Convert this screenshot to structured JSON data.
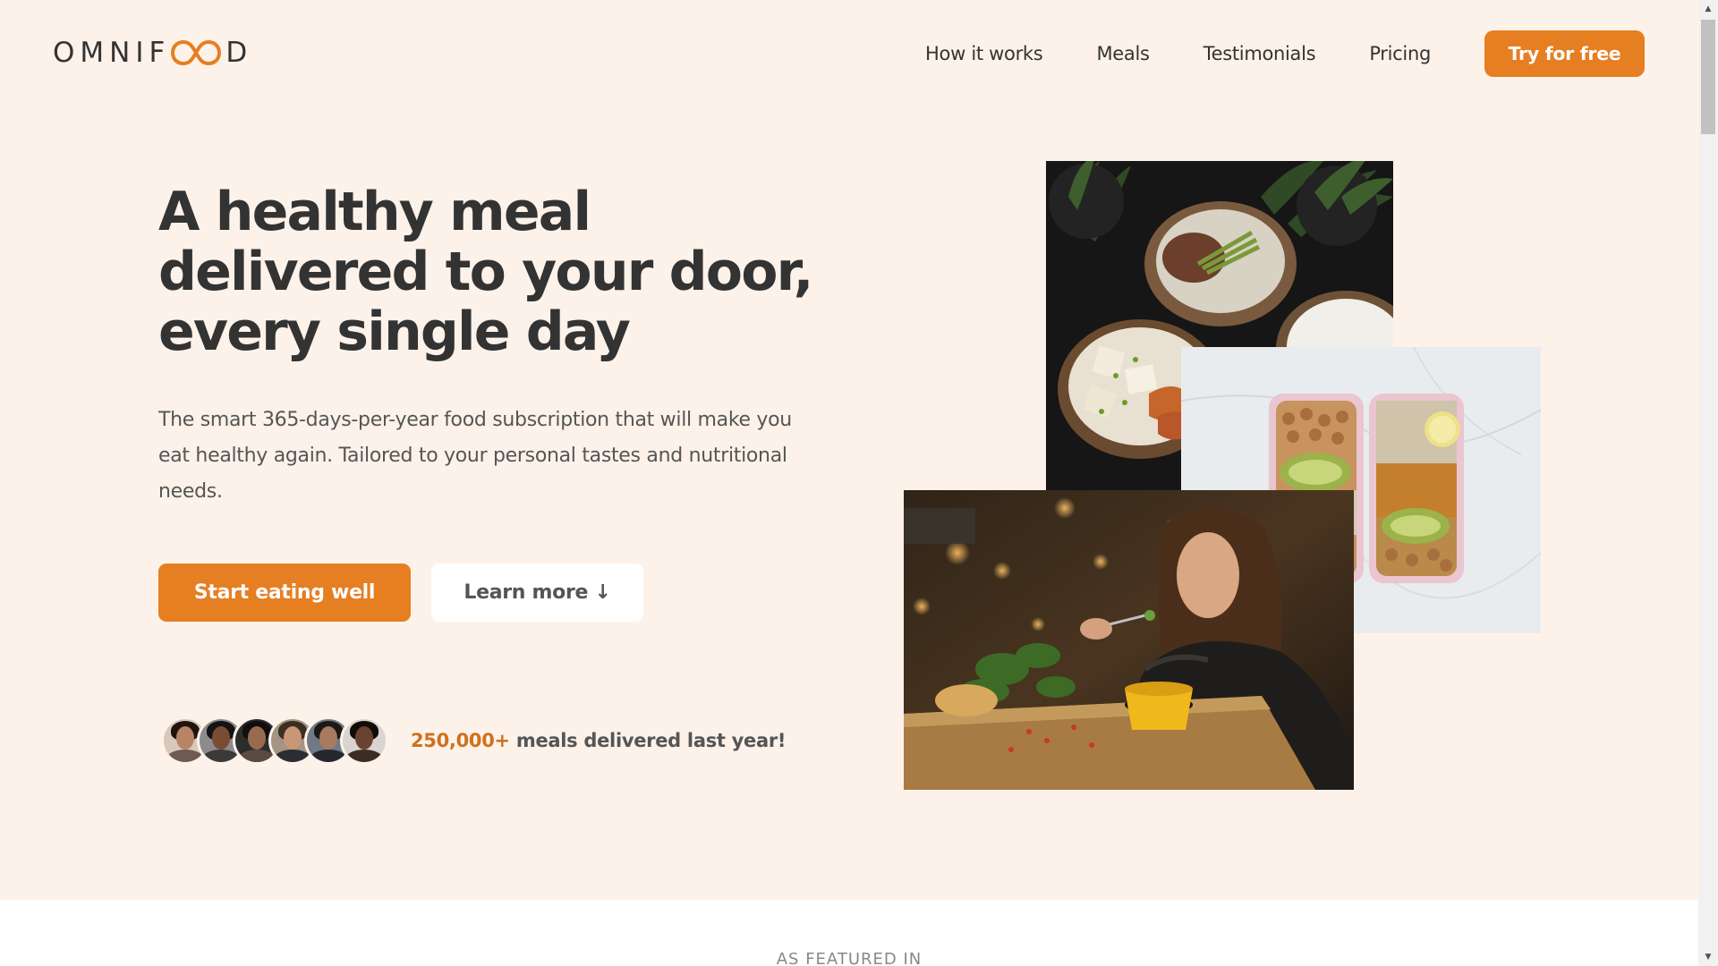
{
  "header": {
    "logo_text_left": "OMNIF",
    "logo_text_right": "D",
    "nav": [
      {
        "label": "How it works"
      },
      {
        "label": "Meals"
      },
      {
        "label": "Testimonials"
      },
      {
        "label": "Pricing"
      }
    ],
    "cta_label": "Try for free"
  },
  "hero": {
    "title": "A healthy meal delivered to your door, every single day",
    "description": "The smart 365-days-per-year food subscription that will make you eat healthy again. Tailored to your personal tastes and nutritional needs.",
    "primary_button": "Start eating well",
    "secondary_button": "Learn more ↓",
    "customers_highlight": "250,000+",
    "customers_text": " meals delivered last year!"
  },
  "featured": {
    "title": "AS FEATURED IN"
  },
  "colors": {
    "accent": "#e67e22",
    "background": "#fdf2e9",
    "text": "#333333"
  },
  "icons": {
    "logo": "infinity-logo-icon",
    "scroll_up": "chevron-up-icon",
    "scroll_down": "chevron-down-icon"
  }
}
